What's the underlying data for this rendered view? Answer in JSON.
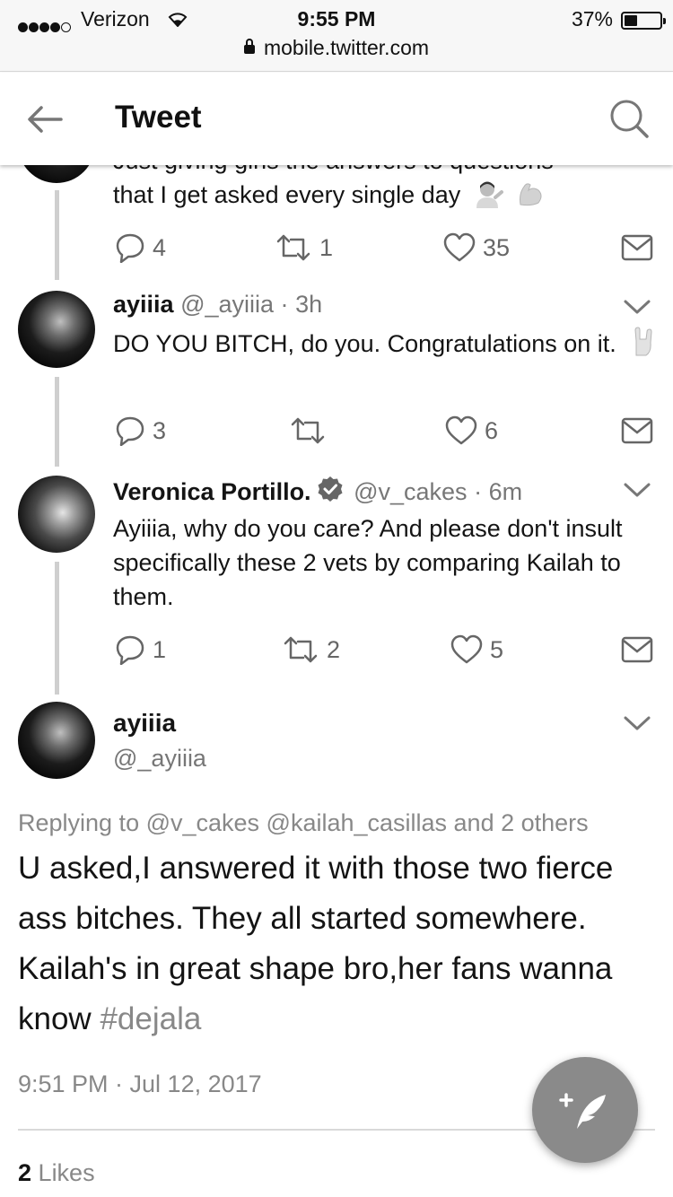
{
  "status_bar": {
    "carrier": "Verizon",
    "time": "9:55 PM",
    "battery": "37%",
    "url": "mobile.twitter.com"
  },
  "header": {
    "title": "Tweet"
  },
  "tweets": [
    {
      "text_partial_top": "Just giving girls the answers to questions",
      "text": "that I get asked every single day",
      "replies": "4",
      "retweets": "1",
      "likes": "35"
    },
    {
      "name": "ayiiia",
      "handle": "@_ayiiia",
      "time": "3h",
      "text": "DO YOU BITCH, do you. Congratulations on it.",
      "replies": "3",
      "retweets": "",
      "likes": "6"
    },
    {
      "name": "Veronica Portillo.",
      "handle": "@v_cakes",
      "time": "6m",
      "text": "Ayiiia, why do you care?  And please don't insult specifically these 2 vets by comparing Kailah to them.",
      "replies": "1",
      "retweets": "2",
      "likes": "5"
    }
  ],
  "main_tweet": {
    "name": "ayiiia",
    "handle": "@_ayiiia",
    "replying_to": "Replying to @v_cakes @kailah_casillas and 2 others",
    "text": "U asked,I answered it with those two fierce ass bitches. They all started somewhere. Kailah's in great shape bro,her fans wanna know ",
    "hashtag": "#dejala",
    "timestamp": "9:51 PM · Jul 12, 2017",
    "likes_count": "2",
    "likes_label": "Likes"
  },
  "icons": {
    "back": "arrow-left-icon",
    "search": "search-icon",
    "reply": "reply-icon",
    "retweet": "retweet-icon",
    "like": "heart-icon",
    "dm": "envelope-icon",
    "compose": "compose-feather-icon"
  },
  "colors": {
    "text": "#141414",
    "secondary": "#777777",
    "fab": "#8a8a8a"
  }
}
